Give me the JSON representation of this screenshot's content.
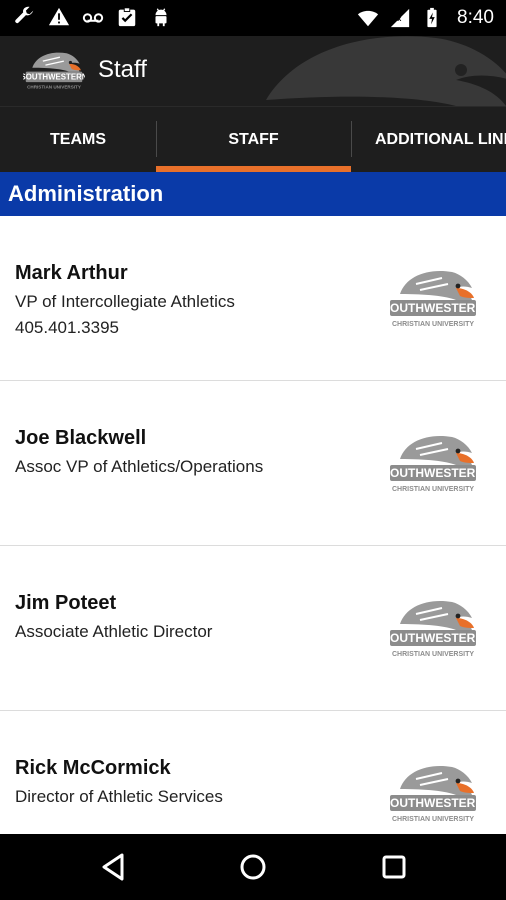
{
  "status_bar": {
    "time": "8:40",
    "icons_left": [
      "wrench-icon",
      "warning-icon",
      "voicemail-icon",
      "clipboard-check-icon",
      "android-icon"
    ],
    "icons_right": [
      "wifi-icon",
      "signal-icon",
      "battery-icon"
    ]
  },
  "app_bar": {
    "title": "Staff",
    "logo": "southwestern-christian-university-eagle-logo"
  },
  "tabs": [
    {
      "label": "TEAMS",
      "selected": false
    },
    {
      "label": "STAFF",
      "selected": true
    },
    {
      "label": "ADDITIONAL LINKS",
      "selected": false
    }
  ],
  "section": {
    "title": "Administration"
  },
  "staff": [
    {
      "name": "Mark Arthur",
      "title": "VP of Intercollegiate Athletics",
      "phone": "405.401.3395"
    },
    {
      "name": "Joe Blackwell",
      "title": "Assoc VP of Athletics/Operations",
      "phone": ""
    },
    {
      "name": "Jim Poteet",
      "title": "Associate Athletic Director",
      "phone": ""
    },
    {
      "name": "Rick McCormick",
      "title": "Director of Athletic Services",
      "phone": ""
    }
  ],
  "nav_bar": {
    "buttons": [
      "back-icon",
      "home-icon",
      "recents-icon"
    ]
  },
  "colors": {
    "accent": "#e8702a",
    "section_blue": "#0a3aa8",
    "app_bar": "#1e1e1e"
  }
}
